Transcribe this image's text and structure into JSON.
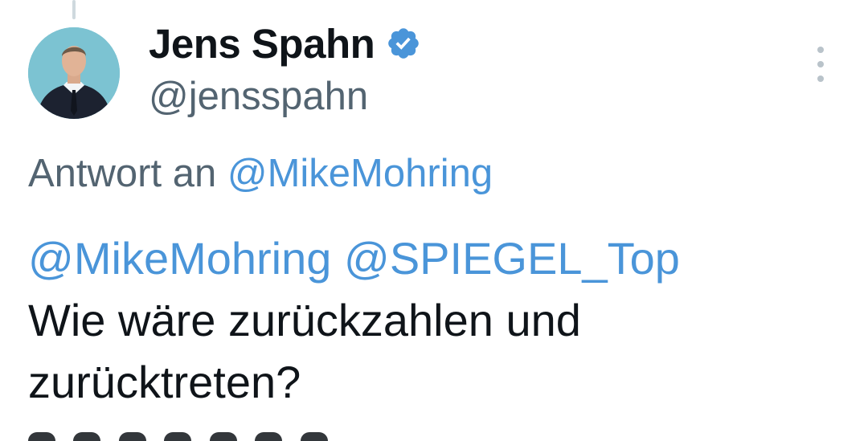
{
  "author": {
    "display_name": "Jens Spahn",
    "handle": "@jensspahn",
    "verified": true
  },
  "reply_context": {
    "prefix": "Antwort an",
    "mention": "@MikeMohring"
  },
  "tweet": {
    "mentions": [
      "@MikeMohring",
      "@SPIEGEL_Top"
    ],
    "text_line1": "Wie wäre zurückzahlen und",
    "text_line2": "zurücktreten?"
  },
  "colors": {
    "mention": "#4a95d9",
    "secondary_text": "#536471",
    "primary_text": "#0f1419",
    "verified_badge": "#4a95d9"
  },
  "icons": {
    "verified": "verified-badge-icon",
    "more": "more-options-icon"
  }
}
